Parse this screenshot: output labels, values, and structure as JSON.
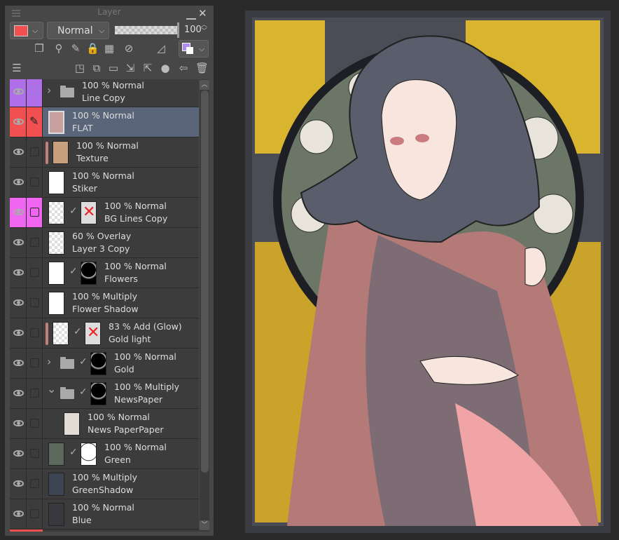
{
  "panel": {
    "title": "Layer",
    "blend_mode": "Normal",
    "opacity": "100",
    "main_color": "#f25050",
    "sub_color": "#b18cf0"
  },
  "toolbar_icons": [
    "clip-to-lower-icon",
    "reference-layer-icon",
    "draft-layer-icon",
    "lock-icon",
    "lock-transparent-icon",
    "mask-toggle-icon",
    "ruler-toggle-icon",
    "layer-color-icon"
  ],
  "action_icons": [
    "new-raster-layer-icon",
    "new-vector-layer-icon",
    "new-folder-icon",
    "transfer-down-icon",
    "merge-down-icon",
    "layer-mask-icon",
    "apply-mask-icon",
    "delete-icon"
  ],
  "layers": [
    {
      "mode": "100 % Normal",
      "name": "Line Copy",
      "col": "#b06ee8",
      "folder": "closed",
      "sel": "frame"
    },
    {
      "mode": "100 % Normal",
      "name": "FLAT",
      "col": "#f25050",
      "sel": "pen",
      "selected": true,
      "thumb": "art"
    },
    {
      "mode": "100 % Normal",
      "name": "Texture",
      "bar": "#c08080",
      "thumb": "tan"
    },
    {
      "mode": "100 % Normal",
      "name": "Stiker",
      "thumb": "white"
    },
    {
      "mode": "100 % Normal",
      "name": "BG Lines Copy",
      "col": "#f066f0",
      "thumb": "checker",
      "mask": "redx"
    },
    {
      "mode": "60 % Overlay",
      "name": "Layer 3 Copy",
      "thumb": "checker"
    },
    {
      "mode": "100 % Normal",
      "name": "Flowers",
      "thumb": "white",
      "mask": "black"
    },
    {
      "mode": "100 % Multiply",
      "name": "Flower Shadow",
      "thumb": "white"
    },
    {
      "mode": "83 % Add (Glow)",
      "name": "Gold light",
      "bar": "#c08080",
      "thumb": "checker",
      "mask": "redx"
    },
    {
      "mode": "100 % Normal",
      "name": "Gold",
      "folder": "closed",
      "mask": "black"
    },
    {
      "mode": "100 % Multiply",
      "name": "NewsPaper",
      "folder": "open",
      "mask": "black"
    },
    {
      "mode": "100 % Normal",
      "name": "News PaperPaper",
      "thumb": "paper",
      "indent": true
    },
    {
      "mode": "100 % Normal",
      "name": "Green",
      "thumb": "green",
      "mask": "white"
    },
    {
      "mode": "100 % Multiply",
      "name": "GreenShadow",
      "thumb": "navy"
    },
    {
      "mode": "100 % Normal",
      "name": "Blue",
      "thumb": "dark"
    }
  ]
}
